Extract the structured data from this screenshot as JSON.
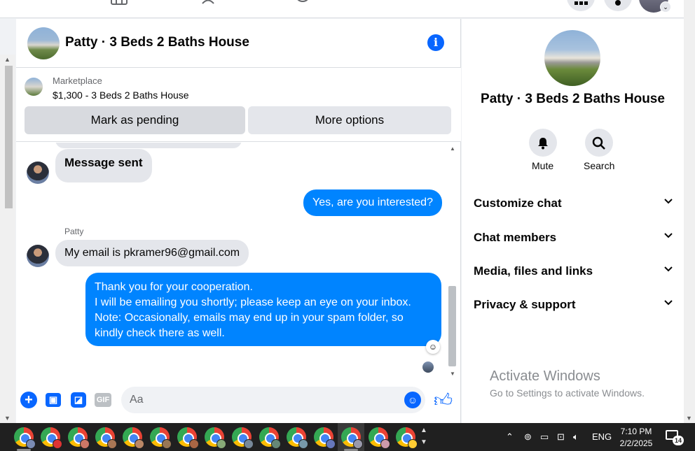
{
  "chat": {
    "title": "Patty · 3 Beds 2 Baths House",
    "marketplace": {
      "label": "Marketplace",
      "item": "$1,300 - 3 Beds 2 Baths House",
      "pending_label": "Mark as pending",
      "more_label": "More options"
    },
    "messages": [
      {
        "dir": "in",
        "text": "Message sent"
      },
      {
        "dir": "out",
        "text": "Yes, are you interested?"
      },
      {
        "dir": "in",
        "sender": "Patty",
        "text": "My email is pkramer96@gmail.com"
      },
      {
        "dir": "out",
        "lines": [
          "Thank you for your cooperation.",
          "I will be emailing you shortly; please keep an eye on your inbox.",
          "Note: Occasionally, emails may end up in your spam folder, so",
          "kindly check there as well."
        ]
      }
    ],
    "composer_placeholder": "Aa",
    "gif_label": "GIF"
  },
  "info": {
    "name": "Patty · 3 Beds 2 Baths House",
    "mute_label": "Mute",
    "search_label": "Search",
    "sections": [
      "Customize chat",
      "Chat members",
      "Media, files and links",
      "Privacy & support"
    ]
  },
  "watermark": {
    "title": "Activate Windows",
    "subtitle": "Go to Settings to activate Windows."
  },
  "taskbar": {
    "lang": "ENG",
    "time": "7:10 PM",
    "date": "2/2/2025",
    "notification_count": "14"
  }
}
